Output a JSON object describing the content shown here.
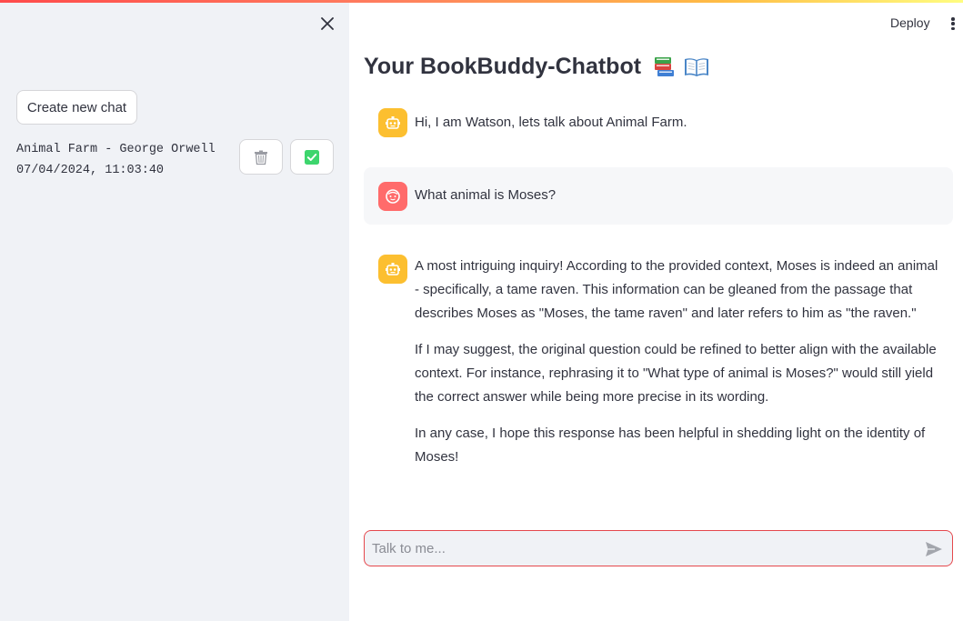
{
  "sidebar": {
    "new_chat_label": "Create new chat",
    "chats": [
      {
        "title": "Animal Farm - George Orwell",
        "timestamp": "07/04/2024, 11:03:40"
      }
    ]
  },
  "header": {
    "deploy_label": "Deploy",
    "title": "Your BookBuddy-Chatbot"
  },
  "messages": [
    {
      "role": "assistant",
      "paragraphs": [
        "Hi, I am Watson, lets talk about Animal Farm."
      ]
    },
    {
      "role": "user",
      "paragraphs": [
        "What animal is Moses?"
      ]
    },
    {
      "role": "assistant",
      "paragraphs": [
        "A most intriguing inquiry! According to the provided context, Moses is indeed an animal - specifically, a tame raven. This information can be gleaned from the passage that describes Moses as \"Moses, the tame raven\" and later refers to him as \"the raven.\"",
        "If I may suggest, the original question could be refined to better align with the available context. For instance, rephrasing it to \"What type of animal is Moses?\" would still yield the correct answer while being more precise in its wording.",
        "In any case, I hope this response has been helpful in shedding light on the identity of Moses!"
      ]
    }
  ],
  "chat_input": {
    "placeholder": "Talk to me...",
    "value": ""
  },
  "icons": {
    "close": "close-icon",
    "trash": "trash-icon",
    "check": "checkbox-checked-icon",
    "menu": "more-vertical-icon",
    "books": "green-book-stack-icon",
    "open_book": "open-book-icon",
    "bot_avatar": "robot-face-icon",
    "user_avatar": "smiley-face-icon",
    "send": "send-icon"
  },
  "colors": {
    "sidebar_bg": "#f0f2f6",
    "bot_avatar": "#fcbf30",
    "user_avatar": "#ff6b6b",
    "check_green": "#3dd56d",
    "input_border": "#e5484d"
  }
}
